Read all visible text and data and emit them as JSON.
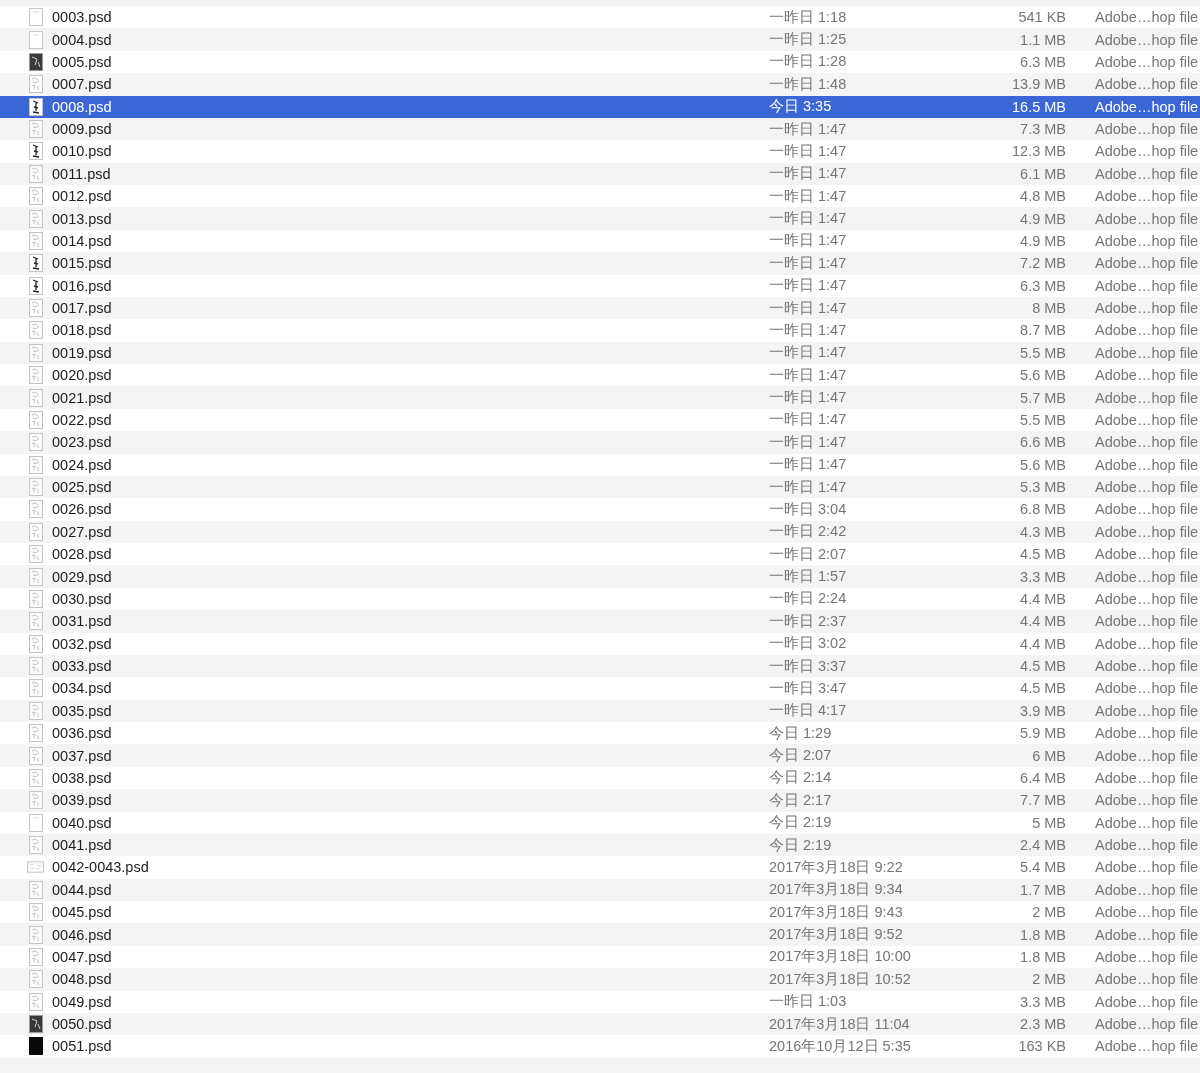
{
  "file_list": {
    "rows": [
      {
        "name": "0003.psd",
        "date": "一昨日 1:18",
        "size": "541 KB",
        "file_type": "Adobe…hop file",
        "kind": "blank",
        "selected": false
      },
      {
        "name": "0004.psd",
        "date": "一昨日 1:25",
        "size": "1.1 MB",
        "file_type": "Adobe…hop file",
        "kind": "blank",
        "selected": false
      },
      {
        "name": "0005.psd",
        "date": "一昨日 1:28",
        "size": "6.3 MB",
        "file_type": "Adobe…hop file",
        "kind": "dark",
        "selected": false
      },
      {
        "name": "0007.psd",
        "date": "一昨日 1:48",
        "size": "13.9 MB",
        "file_type": "Adobe…hop file",
        "kind": "sketch",
        "selected": false
      },
      {
        "name": "0008.psd",
        "date": "今日 3:35",
        "size": "16.5 MB",
        "file_type": "Adobe…hop file",
        "kind": "ink",
        "selected": true
      },
      {
        "name": "0009.psd",
        "date": "一昨日 1:47",
        "size": "7.3 MB",
        "file_type": "Adobe…hop file",
        "kind": "sketch",
        "selected": false
      },
      {
        "name": "0010.psd",
        "date": "一昨日 1:47",
        "size": "12.3 MB",
        "file_type": "Adobe…hop file",
        "kind": "ink",
        "selected": false
      },
      {
        "name": "0011.psd",
        "date": "一昨日 1:47",
        "size": "6.1 MB",
        "file_type": "Adobe…hop file",
        "kind": "sketch",
        "selected": false
      },
      {
        "name": "0012.psd",
        "date": "一昨日 1:47",
        "size": "4.8 MB",
        "file_type": "Adobe…hop file",
        "kind": "sketch",
        "selected": false
      },
      {
        "name": "0013.psd",
        "date": "一昨日 1:47",
        "size": "4.9 MB",
        "file_type": "Adobe…hop file",
        "kind": "sketch",
        "selected": false
      },
      {
        "name": "0014.psd",
        "date": "一昨日 1:47",
        "size": "4.9 MB",
        "file_type": "Adobe…hop file",
        "kind": "sketch",
        "selected": false
      },
      {
        "name": "0015.psd",
        "date": "一昨日 1:47",
        "size": "7.2 MB",
        "file_type": "Adobe…hop file",
        "kind": "ink",
        "selected": false
      },
      {
        "name": "0016.psd",
        "date": "一昨日 1:47",
        "size": "6.3 MB",
        "file_type": "Adobe…hop file",
        "kind": "ink",
        "selected": false
      },
      {
        "name": "0017.psd",
        "date": "一昨日 1:47",
        "size": "8 MB",
        "file_type": "Adobe…hop file",
        "kind": "sketch",
        "selected": false
      },
      {
        "name": "0018.psd",
        "date": "一昨日 1:47",
        "size": "8.7 MB",
        "file_type": "Adobe…hop file",
        "kind": "sketch",
        "selected": false
      },
      {
        "name": "0019.psd",
        "date": "一昨日 1:47",
        "size": "5.5 MB",
        "file_type": "Adobe…hop file",
        "kind": "sketch",
        "selected": false
      },
      {
        "name": "0020.psd",
        "date": "一昨日 1:47",
        "size": "5.6 MB",
        "file_type": "Adobe…hop file",
        "kind": "sketch",
        "selected": false
      },
      {
        "name": "0021.psd",
        "date": "一昨日 1:47",
        "size": "5.7 MB",
        "file_type": "Adobe…hop file",
        "kind": "sketch",
        "selected": false
      },
      {
        "name": "0022.psd",
        "date": "一昨日 1:47",
        "size": "5.5 MB",
        "file_type": "Adobe…hop file",
        "kind": "sketch",
        "selected": false
      },
      {
        "name": "0023.psd",
        "date": "一昨日 1:47",
        "size": "6.6 MB",
        "file_type": "Adobe…hop file",
        "kind": "sketch",
        "selected": false
      },
      {
        "name": "0024.psd",
        "date": "一昨日 1:47",
        "size": "5.6 MB",
        "file_type": "Adobe…hop file",
        "kind": "sketch",
        "selected": false
      },
      {
        "name": "0025.psd",
        "date": "一昨日 1:47",
        "size": "5.3 MB",
        "file_type": "Adobe…hop file",
        "kind": "sketch",
        "selected": false
      },
      {
        "name": "0026.psd",
        "date": "一昨日 3:04",
        "size": "6.8 MB",
        "file_type": "Adobe…hop file",
        "kind": "sketch",
        "selected": false
      },
      {
        "name": "0027.psd",
        "date": "一昨日 2:42",
        "size": "4.3 MB",
        "file_type": "Adobe…hop file",
        "kind": "sketch",
        "selected": false
      },
      {
        "name": "0028.psd",
        "date": "一昨日 2:07",
        "size": "4.5 MB",
        "file_type": "Adobe…hop file",
        "kind": "sketch",
        "selected": false
      },
      {
        "name": "0029.psd",
        "date": "一昨日 1:57",
        "size": "3.3 MB",
        "file_type": "Adobe…hop file",
        "kind": "sketch",
        "selected": false
      },
      {
        "name": "0030.psd",
        "date": "一昨日 2:24",
        "size": "4.4 MB",
        "file_type": "Adobe…hop file",
        "kind": "sketch",
        "selected": false
      },
      {
        "name": "0031.psd",
        "date": "一昨日 2:37",
        "size": "4.4 MB",
        "file_type": "Adobe…hop file",
        "kind": "sketch",
        "selected": false
      },
      {
        "name": "0032.psd",
        "date": "一昨日 3:02",
        "size": "4.4 MB",
        "file_type": "Adobe…hop file",
        "kind": "sketch",
        "selected": false
      },
      {
        "name": "0033.psd",
        "date": "一昨日 3:37",
        "size": "4.5 MB",
        "file_type": "Adobe…hop file",
        "kind": "sketch",
        "selected": false
      },
      {
        "name": "0034.psd",
        "date": "一昨日 3:47",
        "size": "4.5 MB",
        "file_type": "Adobe…hop file",
        "kind": "sketch",
        "selected": false
      },
      {
        "name": "0035.psd",
        "date": "一昨日 4:17",
        "size": "3.9 MB",
        "file_type": "Adobe…hop file",
        "kind": "sketch",
        "selected": false
      },
      {
        "name": "0036.psd",
        "date": "今日 1:29",
        "size": "5.9 MB",
        "file_type": "Adobe…hop file",
        "kind": "sketch",
        "selected": false
      },
      {
        "name": "0037.psd",
        "date": "今日 2:07",
        "size": "6 MB",
        "file_type": "Adobe…hop file",
        "kind": "sketch",
        "selected": false
      },
      {
        "name": "0038.psd",
        "date": "今日 2:14",
        "size": "6.4 MB",
        "file_type": "Adobe…hop file",
        "kind": "sketch",
        "selected": false
      },
      {
        "name": "0039.psd",
        "date": "今日 2:17",
        "size": "7.7 MB",
        "file_type": "Adobe…hop file",
        "kind": "sketch",
        "selected": false
      },
      {
        "name": "0040.psd",
        "date": "今日 2:19",
        "size": "5 MB",
        "file_type": "Adobe…hop file",
        "kind": "blank",
        "selected": false
      },
      {
        "name": "0041.psd",
        "date": "今日 2:19",
        "size": "2.4 MB",
        "file_type": "Adobe…hop file",
        "kind": "sketch",
        "selected": false
      },
      {
        "name": "0042-0043.psd",
        "date": "2017年3月18日 9:22",
        "size": "5.4 MB",
        "file_type": "Adobe…hop file",
        "kind": "wide",
        "selected": false
      },
      {
        "name": "0044.psd",
        "date": "2017年3月18日 9:34",
        "size": "1.7 MB",
        "file_type": "Adobe…hop file",
        "kind": "sketch",
        "selected": false
      },
      {
        "name": "0045.psd",
        "date": "2017年3月18日 9:43",
        "size": "2 MB",
        "file_type": "Adobe…hop file",
        "kind": "sketch",
        "selected": false
      },
      {
        "name": "0046.psd",
        "date": "2017年3月18日 9:52",
        "size": "1.8 MB",
        "file_type": "Adobe…hop file",
        "kind": "sketch",
        "selected": false
      },
      {
        "name": "0047.psd",
        "date": "2017年3月18日 10:00",
        "size": "1.8 MB",
        "file_type": "Adobe…hop file",
        "kind": "sketch",
        "selected": false
      },
      {
        "name": "0048.psd",
        "date": "2017年3月18日 10:52",
        "size": "2 MB",
        "file_type": "Adobe…hop file",
        "kind": "sketch",
        "selected": false
      },
      {
        "name": "0049.psd",
        "date": "一昨日 1:03",
        "size": "3.3 MB",
        "file_type": "Adobe…hop file",
        "kind": "sketch",
        "selected": false
      },
      {
        "name": "0050.psd",
        "date": "2017年3月18日 11:04",
        "size": "2.3 MB",
        "file_type": "Adobe…hop file",
        "kind": "dark",
        "selected": false
      },
      {
        "name": "0051.psd",
        "date": "2016年10月12日 5:35",
        "size": "163 KB",
        "file_type": "Adobe…hop file",
        "kind": "black",
        "selected": false
      }
    ]
  }
}
